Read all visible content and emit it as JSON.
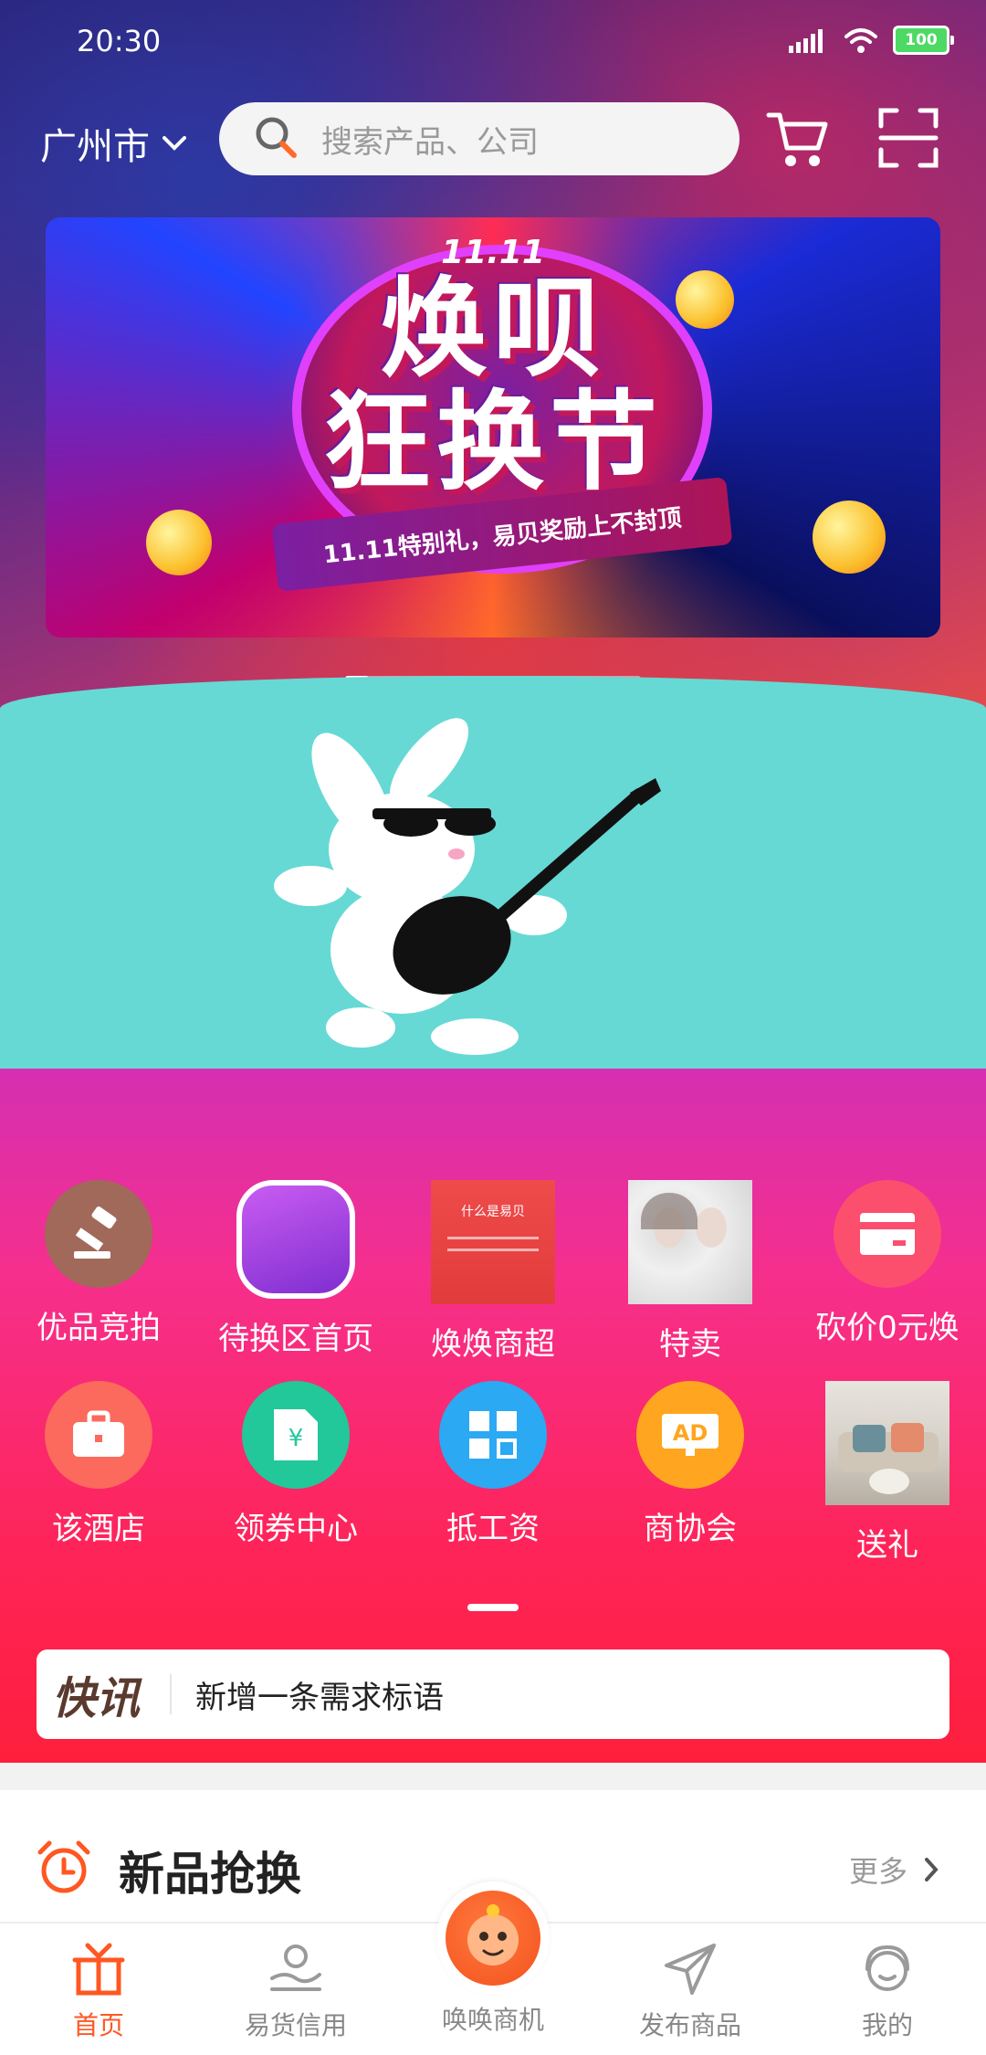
{
  "status_bar": {
    "time": "20:30",
    "battery": "100"
  },
  "header": {
    "city": "广州市",
    "search_placeholder": "搜索产品、公司"
  },
  "banner": {
    "badge": "11.11",
    "title_line1": "焕呗",
    "title_line2": "狂换节",
    "ribbon": "11.11特别礼，易贝奖励上不封顶"
  },
  "grid": {
    "items": [
      {
        "label": "优品竞拍",
        "icon": "gavel-icon",
        "color": "#a1695a"
      },
      {
        "label": "待换区首页",
        "icon": "purple-app-icon",
        "color": "#9b3fd8"
      },
      {
        "label": "焕焕商超",
        "icon": "thumbnail-image"
      },
      {
        "label": "特卖",
        "icon": "photo-thumbnail"
      },
      {
        "label": "砍价0元焕",
        "icon": "card-icon",
        "color": "#fb4f6d"
      },
      {
        "label": "该酒店",
        "icon": "briefcase-icon",
        "color": "#fb6a5c"
      },
      {
        "label": "领券中心",
        "icon": "coupon-icon",
        "color": "#22c79a"
      },
      {
        "label": "抵工资",
        "icon": "grid-icon",
        "color": "#2ba9f3"
      },
      {
        "label": "商协会",
        "icon": "ad-icon",
        "color": "#ffa51f"
      },
      {
        "label": "送礼",
        "icon": "sofa-photo"
      }
    ],
    "thumb_heading": "什么是易贝"
  },
  "news": {
    "logo": "快讯",
    "text": "新增一条需求标语"
  },
  "section": {
    "title": "新品抢换",
    "more": "更多"
  },
  "tabbar": {
    "items": [
      {
        "label": "首页",
        "icon": "home-gift-icon",
        "active": true
      },
      {
        "label": "易货信用",
        "icon": "credit-hand-icon"
      },
      {
        "label": "唤唤商机",
        "icon": "monkey-avatar-icon"
      },
      {
        "label": "发布商品",
        "icon": "send-plane-icon"
      },
      {
        "label": "我的",
        "icon": "profile-face-icon"
      }
    ]
  },
  "colors": {
    "accent": "#ff5722",
    "grid_top": "#d52fb2",
    "grid_bottom": "#fe1f3c",
    "gif_bg": "#66d9d4"
  }
}
